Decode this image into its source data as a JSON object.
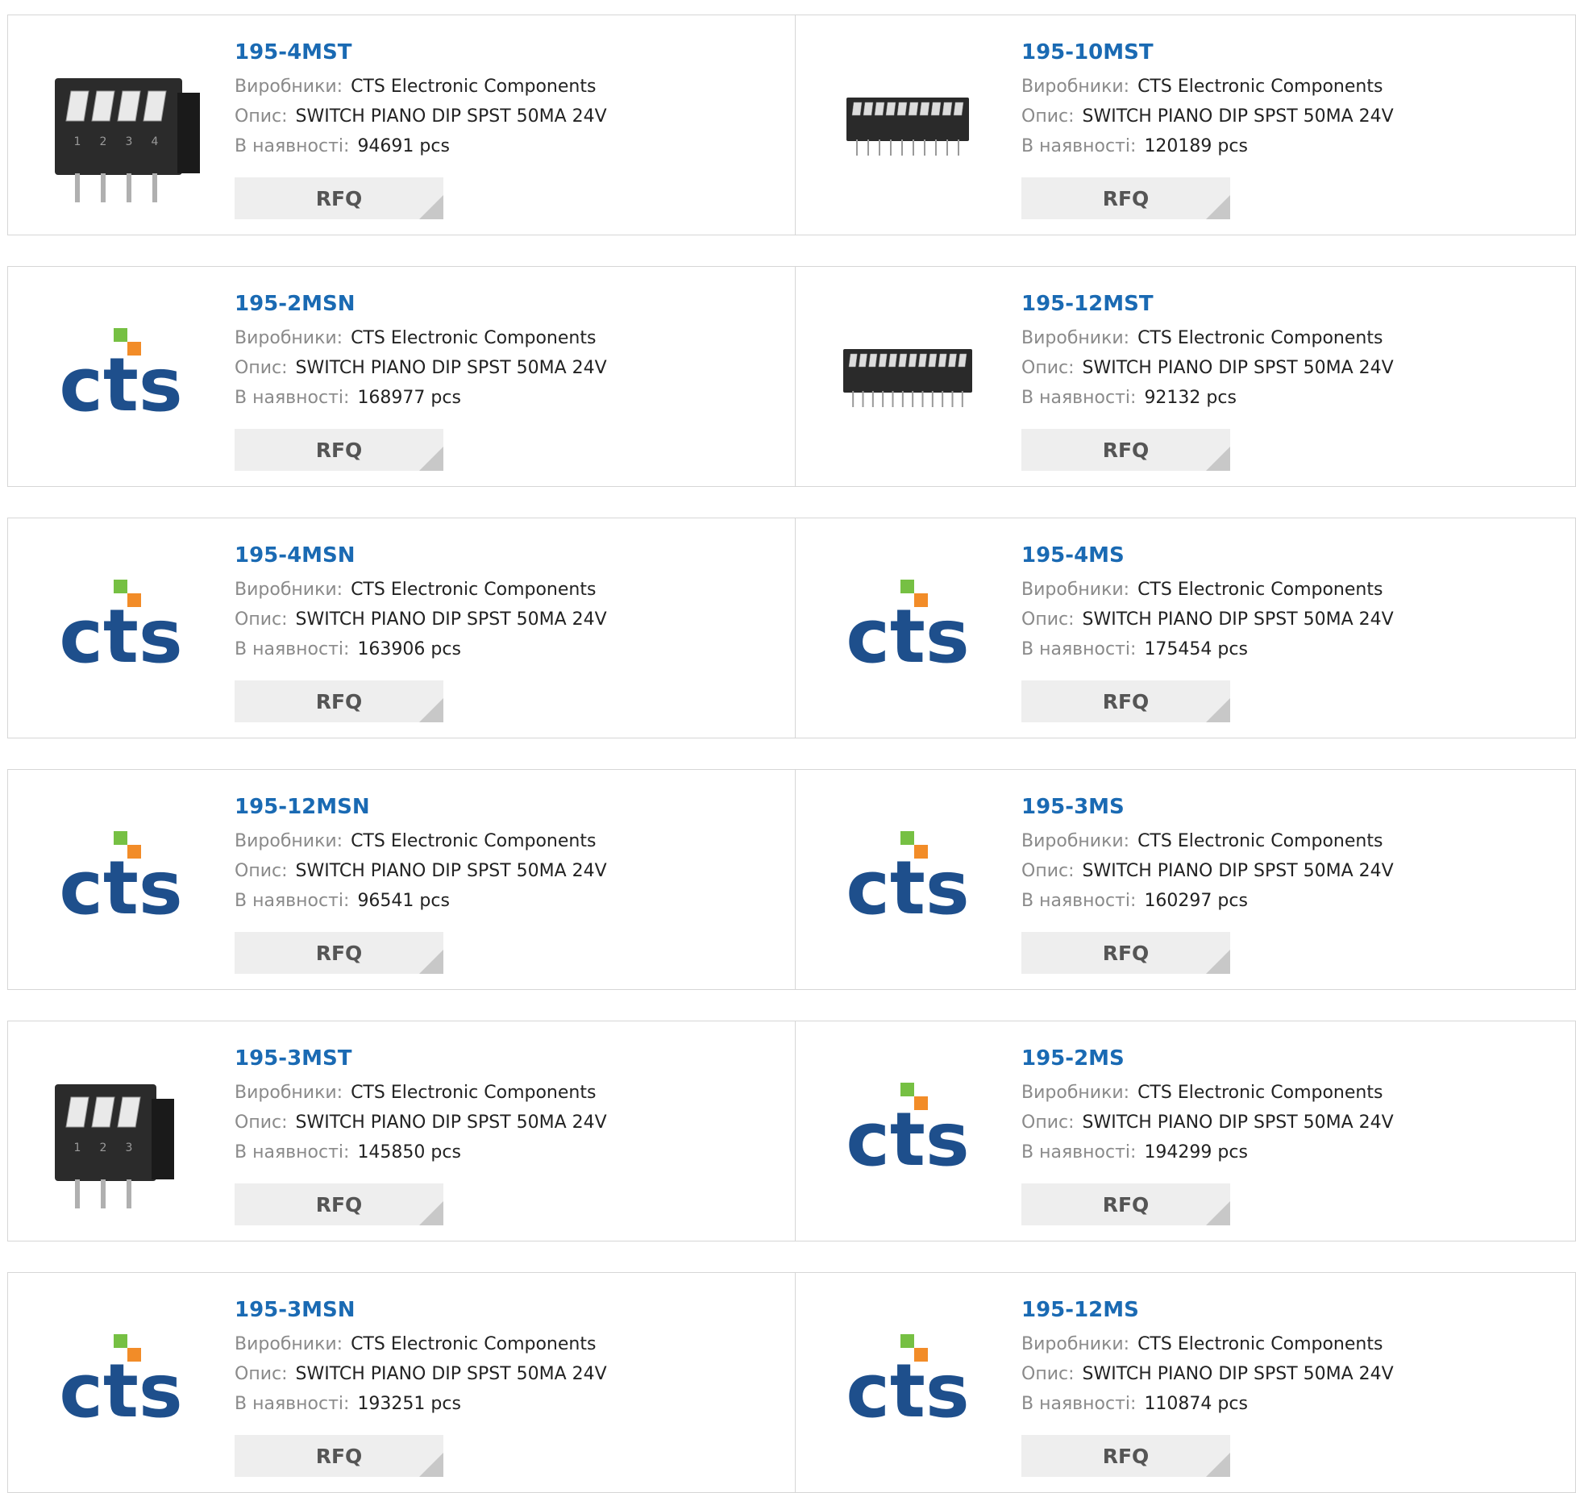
{
  "labels": {
    "manufacturer": "Виробники:",
    "description": "Опис:",
    "stock": "В наявності:",
    "rfq": "RFQ"
  },
  "colors": {
    "link": "#1a6ab3",
    "cts_blue": "#1e4f8c",
    "cts_green": "#76c043",
    "cts_orange": "#f28c28"
  },
  "products": [
    {
      "name": "195-4MST",
      "manufacturer": "CTS Electronic Components",
      "description": "SWITCH PIANO DIP SPST 50MA 24V",
      "stock": "94691 pcs",
      "image": "dip-switch-4-photo"
    },
    {
      "name": "195-10MST",
      "manufacturer": "CTS Electronic Components",
      "description": "SWITCH PIANO DIP SPST 50MA 24V",
      "stock": "120189 pcs",
      "image": "dip-switch-10-photo"
    },
    {
      "name": "195-2MSN",
      "manufacturer": "CTS Electronic Components",
      "description": "SWITCH PIANO DIP SPST 50MA 24V",
      "stock": "168977 pcs",
      "image": "cts-logo"
    },
    {
      "name": "195-12MST",
      "manufacturer": "CTS Electronic Components",
      "description": "SWITCH PIANO DIP SPST 50MA 24V",
      "stock": "92132 pcs",
      "image": "dip-switch-12-photo"
    },
    {
      "name": "195-4MSN",
      "manufacturer": "CTS Electronic Components",
      "description": "SWITCH PIANO DIP SPST 50MA 24V",
      "stock": "163906 pcs",
      "image": "cts-logo"
    },
    {
      "name": "195-4MS",
      "manufacturer": "CTS Electronic Components",
      "description": "SWITCH PIANO DIP SPST 50MA 24V",
      "stock": "175454 pcs",
      "image": "cts-logo"
    },
    {
      "name": "195-12MSN",
      "manufacturer": "CTS Electronic Components",
      "description": "SWITCH PIANO DIP SPST 50MA 24V",
      "stock": "96541 pcs",
      "image": "cts-logo"
    },
    {
      "name": "195-3MS",
      "manufacturer": "CTS Electronic Components",
      "description": "SWITCH PIANO DIP SPST 50MA 24V",
      "stock": "160297 pcs",
      "image": "cts-logo"
    },
    {
      "name": "195-3MST",
      "manufacturer": "CTS Electronic Components",
      "description": "SWITCH PIANO DIP SPST 50MA 24V",
      "stock": "145850 pcs",
      "image": "dip-switch-3-photo"
    },
    {
      "name": "195-2MS",
      "manufacturer": "CTS Electronic Components",
      "description": "SWITCH PIANO DIP SPST 50MA 24V",
      "stock": "194299 pcs",
      "image": "cts-logo"
    },
    {
      "name": "195-3MSN",
      "manufacturer": "CTS Electronic Components",
      "description": "SWITCH PIANO DIP SPST 50MA 24V",
      "stock": "193251 pcs",
      "image": "cts-logo"
    },
    {
      "name": "195-12MS",
      "manufacturer": "CTS Electronic Components",
      "description": "SWITCH PIANO DIP SPST 50MA 24V",
      "stock": "110874 pcs",
      "image": "cts-logo"
    }
  ]
}
